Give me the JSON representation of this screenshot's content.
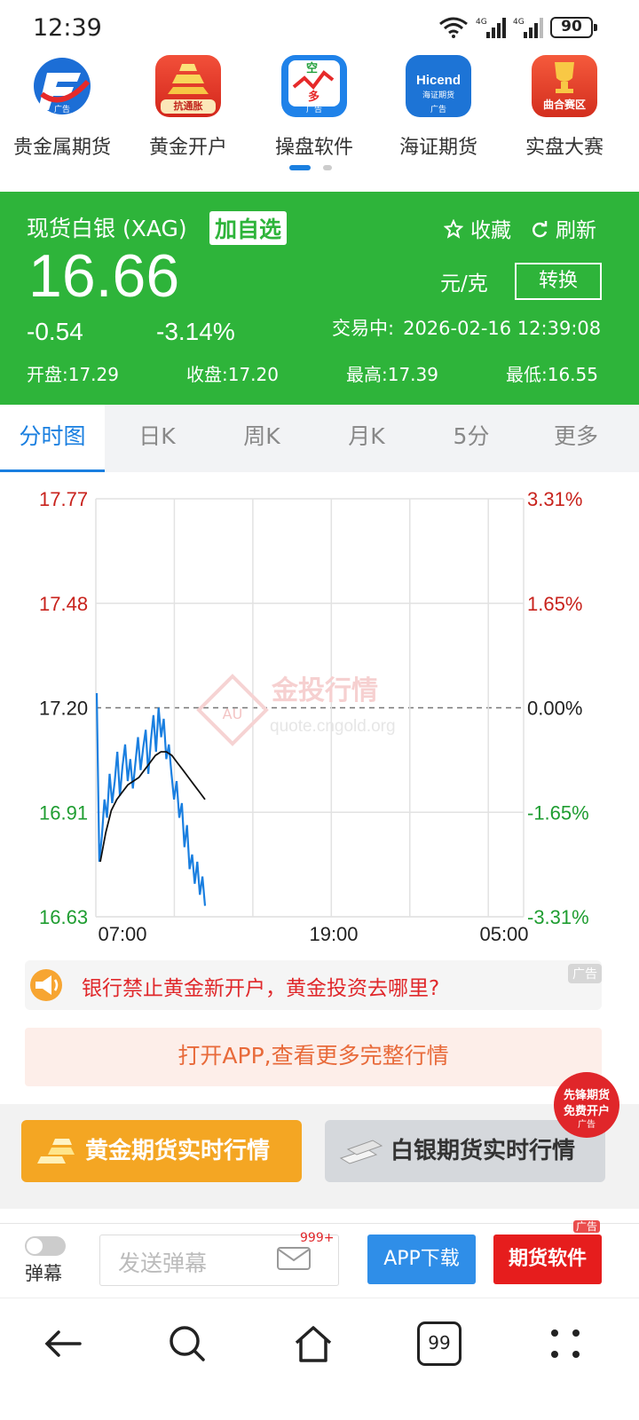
{
  "status_bar": {
    "time": "12:39",
    "battery": "90",
    "signal1": "4G",
    "signal2": "4G"
  },
  "apps": [
    {
      "label": "贵金属期货",
      "ad": "广告"
    },
    {
      "label": "黄金开户",
      "badge": "抗通胀"
    },
    {
      "label": "操盘软件",
      "ad": "广告",
      "icon_top": "空",
      "icon_bottom": "多"
    },
    {
      "label": "海证期货",
      "brand": "Hicend",
      "brand_sub": "海证期货",
      "ad": "广告"
    },
    {
      "label": "实盘大赛",
      "badge": "曲合赛区"
    }
  ],
  "quote": {
    "name": "现货白银 (XAG)",
    "add_label": "加自选",
    "fav_label": "收藏",
    "refresh_label": "刷新",
    "price": "16.66",
    "unit": "元/克",
    "convert_label": "转换",
    "change": "-0.54",
    "change_pct": "-3.14%",
    "status": "交易中:",
    "timestamp": "2026-02-16 12:39:08",
    "open": "开盘:17.29",
    "close": "收盘:17.20",
    "high": "最高:17.39",
    "low": "最低:16.55",
    "color": "#2eb43a"
  },
  "tabs": [
    "分时图",
    "日K",
    "周K",
    "月K",
    "5分",
    "更多"
  ],
  "chart_data": {
    "type": "line",
    "y_left_ticks": [
      "17.77",
      "17.48",
      "17.20",
      "16.91",
      "16.63"
    ],
    "y_right_ticks": [
      "3.31%",
      "1.65%",
      "0.00%",
      "-1.65%",
      "-3.31%"
    ],
    "x_ticks": [
      "07:00",
      "19:00",
      "05:00"
    ],
    "ylim": [
      16.63,
      17.77
    ],
    "prev_close": 17.2,
    "watermark": "金投行情",
    "watermark_url": "quote.cngold.org",
    "watermark_logo": "AU",
    "series": [
      {
        "color": "#1a7fe0",
        "values": [
          17.24,
          16.78,
          16.85,
          16.95,
          16.9,
          17.02,
          16.94,
          17.0,
          17.08,
          16.96,
          17.04,
          17.1,
          17.0,
          17.06,
          16.98,
          17.05,
          17.12,
          17.03,
          17.09,
          17.14,
          17.02,
          17.11,
          17.18,
          17.08,
          17.2,
          17.12,
          17.17,
          17.06,
          17.1,
          17.02,
          16.95,
          17.0,
          16.9,
          16.94,
          16.82,
          16.88,
          16.76,
          16.8,
          16.72,
          16.78,
          16.69,
          16.74,
          16.66
        ]
      },
      {
        "color": "#111111",
        "values": [
          16.78,
          16.86,
          16.92,
          16.95,
          16.97,
          16.99,
          17.0,
          17.01,
          17.03,
          17.05,
          17.07,
          17.08,
          17.08,
          17.07,
          17.05,
          17.03,
          17.01,
          16.99,
          16.97,
          16.95
        ]
      }
    ]
  },
  "ad_banner": {
    "text": "银行禁止黄金新开户，黄金投资去哪里?",
    "tag": "广告"
  },
  "open_app": "打开APP,查看更多完整行情",
  "futures": {
    "gold": "黄金期货实时行情",
    "silver": "白银期货实时行情",
    "float_line1": "先锋期货",
    "float_line2": "免费开户",
    "float_tag": "广告"
  },
  "bottom_bar": {
    "toggle_label": "弹幕",
    "danmu_placeholder": "发送弹幕",
    "badge": "999+",
    "app_download": "APP下载",
    "futures_software": "期货软件",
    "tag": "广告"
  },
  "nav": {
    "tabs_count": "99"
  }
}
